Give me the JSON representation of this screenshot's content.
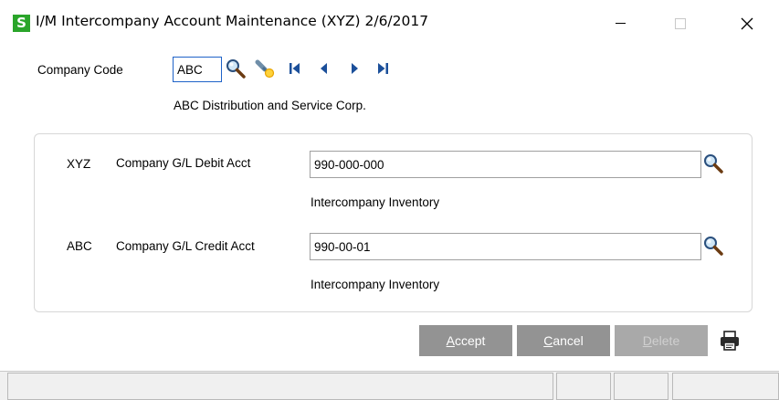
{
  "window": {
    "app_icon_letter": "S",
    "title": "I/M Intercompany Account Maintenance (XYZ) 2/6/2017"
  },
  "company": {
    "label": "Company Code",
    "value": "ABC",
    "name": "ABC Distribution and Service Corp."
  },
  "debit": {
    "company": "XYZ",
    "label": "Company G/L Debit Acct",
    "value": "990-000-000",
    "description": "Intercompany Inventory"
  },
  "credit": {
    "company": "ABC",
    "label": "Company G/L Credit Acct",
    "value": "990-00-01",
    "description": "Intercompany Inventory"
  },
  "buttons": {
    "accept": {
      "hotkey": "A",
      "rest": "ccept"
    },
    "cancel": {
      "hotkey": "C",
      "rest": "ancel"
    },
    "delete": {
      "hotkey": "D",
      "rest": "elete"
    }
  },
  "colors": {
    "app_icon": "#2aa52a",
    "button_bg": "#939393",
    "button_disabled_bg": "#a9a9a9",
    "focus_border": "#1f63c8"
  },
  "icons": {
    "lookup": "magnifier-icon",
    "wizard": "flashlight-icon",
    "first": "first-record-icon",
    "prev": "previous-record-icon",
    "next": "next-record-icon",
    "last": "last-record-icon",
    "print": "printer-icon"
  }
}
